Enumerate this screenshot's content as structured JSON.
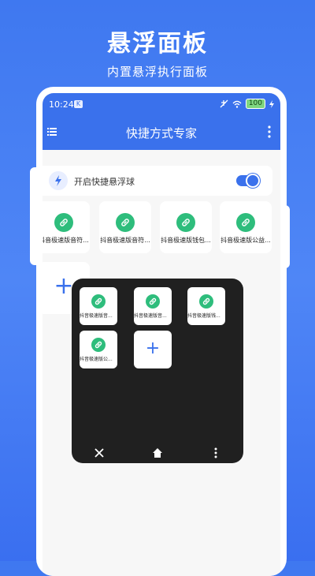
{
  "promo": {
    "title": "悬浮面板",
    "subtitle": "内置悬浮执行面板"
  },
  "status_bar": {
    "time": "10:24",
    "app_icon": "K",
    "battery": "100"
  },
  "app_bar": {
    "title": "快捷方式专家",
    "menu_icon": "hamburger-icon",
    "more_icon": "more-vert-icon"
  },
  "float_toggle": {
    "label": "开启快捷悬浮球",
    "enabled": true,
    "icon": "lightning-icon"
  },
  "shortcuts": [
    {
      "label": "抖音极速版音符..."
    },
    {
      "label": "抖音极速版音符..."
    },
    {
      "label": "抖音极速版钱包..."
    },
    {
      "label": "抖音极速版公益..."
    }
  ],
  "add_label": "+",
  "float_panel": {
    "items": [
      {
        "label": "抖音极速版音..."
      },
      {
        "label": "抖音极速版音..."
      },
      {
        "label": "抖音极速版钱..."
      },
      {
        "label": "抖音极速版公..."
      }
    ],
    "add_label": "+",
    "controls": [
      "close-icon",
      "home-icon",
      "more-vert-icon"
    ]
  },
  "colors": {
    "primary": "#3a71ec",
    "link_green": "#2ebd7c",
    "panel": "#202020"
  }
}
